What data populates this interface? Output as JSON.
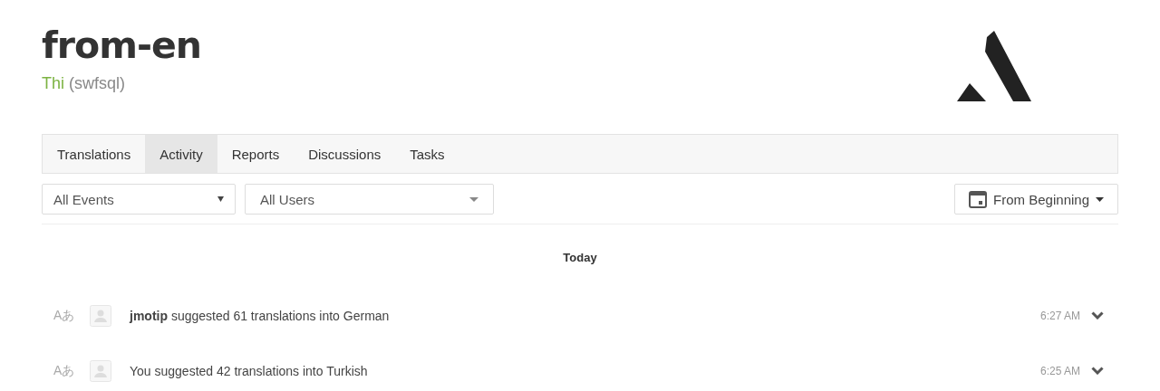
{
  "header": {
    "title": "from-en",
    "language": "Thi",
    "code": "(swfsql)"
  },
  "tabs": [
    {
      "label": "Translations",
      "selected": false
    },
    {
      "label": "Activity",
      "selected": true
    },
    {
      "label": "Reports",
      "selected": false
    },
    {
      "label": "Discussions",
      "selected": false
    },
    {
      "label": "Tasks",
      "selected": false
    }
  ],
  "filters": {
    "events": "All Events",
    "users": "All Users",
    "period": "From Beginning"
  },
  "day": "Today",
  "activities": [
    {
      "icon": "Aあ",
      "text": "**jmotip** suggested 61 translations into German",
      "time": "6:27 AM"
    },
    {
      "icon": "Aあ",
      "text": "You suggested 42 translations into Turkish",
      "time": "6:25 AM"
    }
  ]
}
